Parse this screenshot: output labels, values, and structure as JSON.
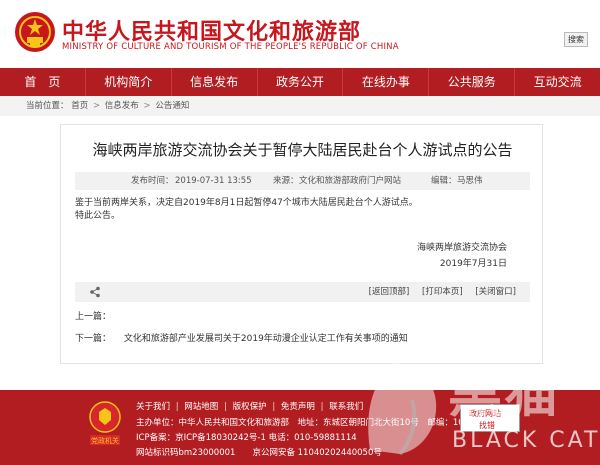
{
  "header": {
    "title_cn": "中华人民共和国文化和旅游部",
    "title_en": "MINISTRY OF CULTURE AND TOURISM OF THE PEOPLE'S REPUBLIC OF CHINA",
    "search_label": "搜索"
  },
  "nav": {
    "items": [
      {
        "label": "首　页"
      },
      {
        "label": "机构简介"
      },
      {
        "label": "信息发布"
      },
      {
        "label": "政务公开"
      },
      {
        "label": "在线办事"
      },
      {
        "label": "公共服务"
      },
      {
        "label": "互动交流"
      }
    ]
  },
  "breadcrumb": {
    "prefix": "当前位置：",
    "items": [
      "首页",
      "信息发布",
      "公告通知"
    ],
    "sep": ">"
  },
  "article": {
    "title": "海峡两岸旅游交流协会关于暂停大陆居民赴台个人游试点的公告",
    "meta": {
      "publish_label": "发布时间：",
      "publish_value": "2019-07-31 13:55",
      "source_label": "来源：",
      "source_value": "文化和旅游部政府门户网站",
      "editor_label": "编辑：",
      "editor_value": "马思伟"
    },
    "paragraphs": [
      "鉴于当前两岸关系，决定自2019年8月1日起暂停47个城市大陆居民赴台个人游试点。",
      "特此公告。"
    ],
    "signature_org": "海峡两岸旅游交流协会",
    "signature_date": "2019年7月31日",
    "actions": [
      "[返回顶部]",
      "[打印本页]",
      "[关闭窗口]"
    ],
    "prev_label": "上一篇：",
    "next_label": "下一篇：",
    "next_title": "文化和旅游部产业发展司关于2019年动漫企业认定工作有关事项的通知"
  },
  "footer": {
    "badge_text": "党政机关",
    "links": [
      "关于我们",
      "网站地图",
      "版权保护",
      "免责声明",
      "联系我们"
    ],
    "line1": "主办单位：中华人民共和国文化和旅游部　地址：东城区朝阳门北大街10号　邮编：100020",
    "line2": "ICP备案：京ICP备18030242号-1 电话：010-59881114",
    "line3": "网站标识码bm23000001　　京公网安备 11040202440050号",
    "gov_badge_top": "政府网站",
    "gov_badge_bottom": "找错"
  },
  "watermark": {
    "text_cn": "黑猫",
    "text_en": "BLACK CAT"
  },
  "colors": {
    "brand_red": "#b21d21",
    "title_red": "#c8161d"
  }
}
